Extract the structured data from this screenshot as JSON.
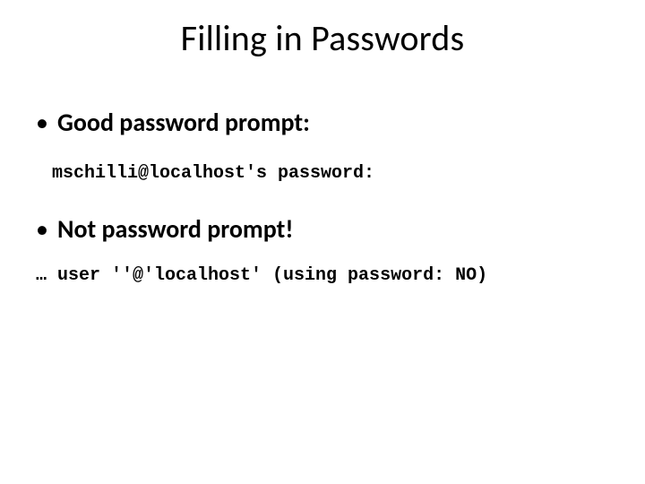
{
  "title": "Filling in Passwords",
  "bullets": [
    {
      "label": "Good password prompt:"
    },
    {
      "label": "Not password prompt!"
    }
  ],
  "code_lines": [
    " mschilli@localhost's password:",
    "… user ''@'localhost' (using password: NO)"
  ]
}
